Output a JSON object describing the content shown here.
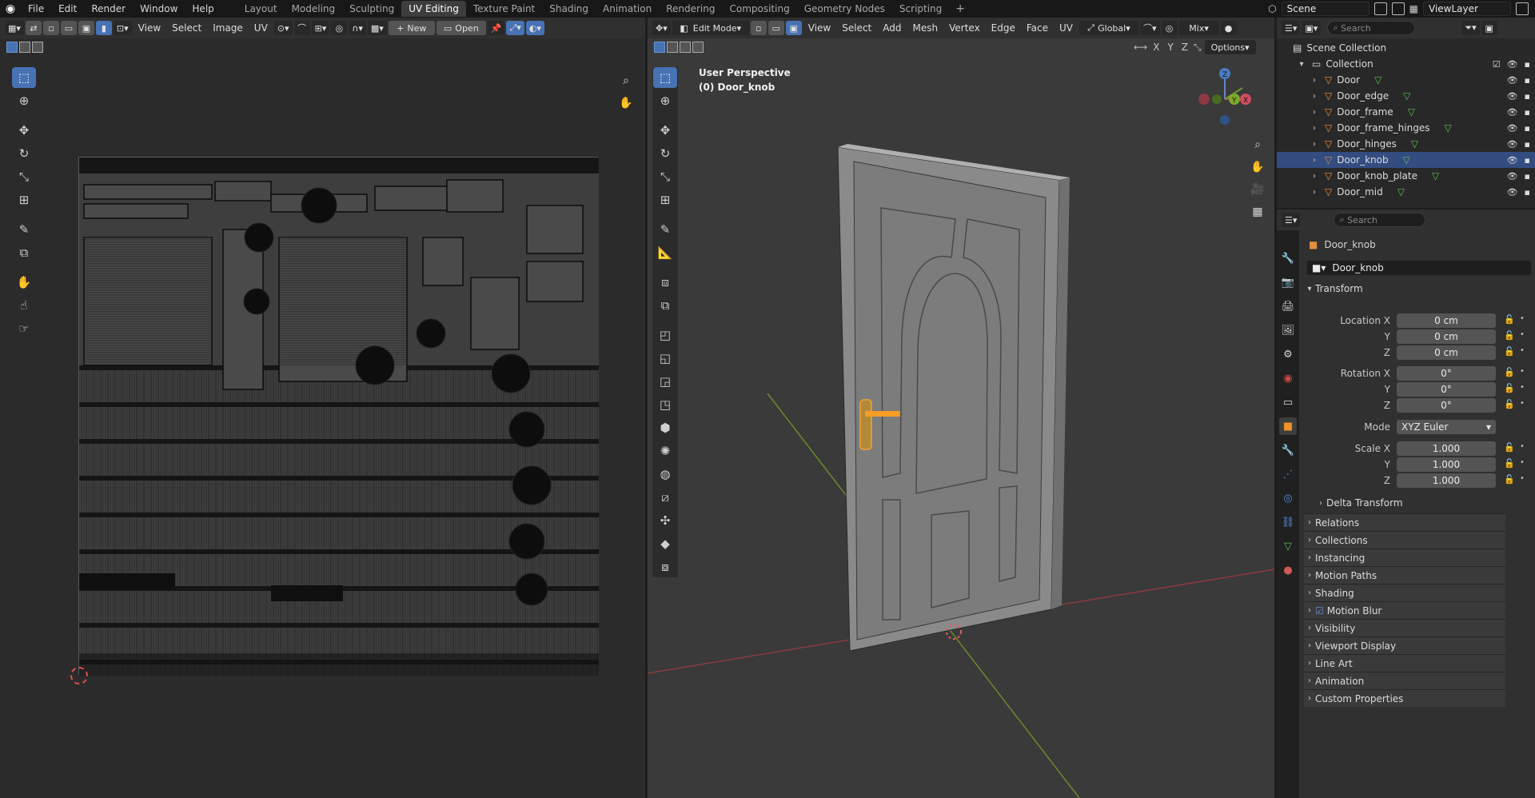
{
  "topbar": {
    "menus": [
      "File",
      "Edit",
      "Render",
      "Window",
      "Help"
    ],
    "workspaces": [
      "Layout",
      "Modeling",
      "Sculpting",
      "UV Editing",
      "Texture Paint",
      "Shading",
      "Animation",
      "Rendering",
      "Compositing",
      "Geometry Nodes",
      "Scripting"
    ],
    "active_workspace": "UV Editing",
    "add_label": "+",
    "scene": "Scene",
    "view_layer": "ViewLayer"
  },
  "uv_editor": {
    "menus": [
      "View",
      "Select",
      "Image",
      "UV"
    ],
    "new_label": "New",
    "open_label": "Open"
  },
  "viewport": {
    "mode": "Edit Mode",
    "menus": [
      "View",
      "Select",
      "Add",
      "Mesh",
      "Vertex",
      "Edge",
      "Face",
      "UV"
    ],
    "orientation": "Global",
    "shading": "Mix",
    "options_label": "Options",
    "axes": [
      "X",
      "Y",
      "Z"
    ],
    "view_name": "User Perspective",
    "object_label": "(0) Door_knob"
  },
  "outliner": {
    "search_placeholder": "Search",
    "scene_collection": "Scene Collection",
    "collection": "Collection",
    "objects": [
      "Door",
      "Door_edge",
      "Door_frame",
      "Door_frame_hinges",
      "Door_hinges",
      "Door_knob",
      "Door_knob_plate",
      "Door_mid"
    ],
    "selected_object": "Door_knob"
  },
  "properties": {
    "search_placeholder": "Search",
    "object_name": "Door_knob",
    "object_field": "Door_knob",
    "transform_label": "Transform",
    "location_label": "Location X",
    "rotation_label": "Rotation X",
    "scale_label": "Scale X",
    "mode_label": "Mode",
    "y_label": "Y",
    "z_label": "Z",
    "location": [
      "0 cm",
      "0 cm",
      "0 cm"
    ],
    "rotation": [
      "0°",
      "0°",
      "0°"
    ],
    "rotation_mode": "XYZ Euler",
    "scale": [
      "1.000",
      "1.000",
      "1.000"
    ],
    "delta_transform": "Delta Transform",
    "panels": [
      "Relations",
      "Collections",
      "Instancing",
      "Motion Paths",
      "Shading",
      "Motion Blur",
      "Visibility",
      "Viewport Display",
      "Line Art",
      "Animation",
      "Custom Properties"
    ]
  },
  "colors": {
    "accent": "#4772b3",
    "selection": "#f59d24",
    "grid_red": "#9c3b3b",
    "grid_green": "#6f8a2c"
  }
}
